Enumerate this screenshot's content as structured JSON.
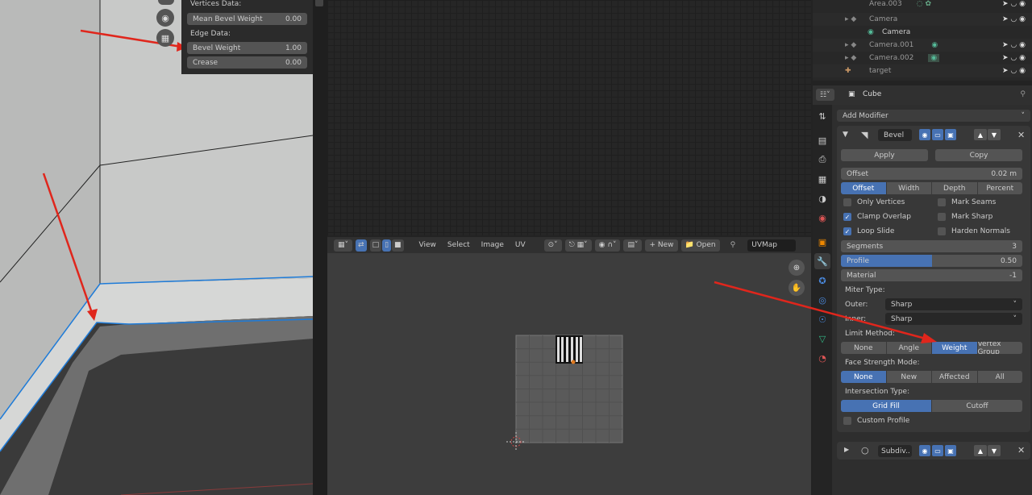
{
  "viewport": {
    "vertices_data_label": "Vertices Data:",
    "mean_bevel_weight_label": "Mean Bevel Weight",
    "mean_bevel_weight_value": "0.00",
    "edge_data_label": "Edge Data:",
    "bevel_weight_label": "Bevel Weight",
    "bevel_weight_value": "1.00",
    "crease_label": "Crease",
    "crease_value": "0.00"
  },
  "uv_editor": {
    "menu": [
      "View",
      "Select",
      "Image",
      "UV"
    ],
    "new_label": "New",
    "open_label": "Open",
    "uvmap_label": "UVMap"
  },
  "outliner": {
    "items": [
      "Area.003",
      "Camera",
      "Camera",
      "Camera.001",
      "Camera.002",
      "target"
    ]
  },
  "properties": {
    "object_name": "Cube",
    "add_modifier": "Add Modifier",
    "bevel": {
      "name": "Bevel",
      "apply": "Apply",
      "copy": "Copy",
      "offset_label": "Offset",
      "offset_value": "0.02 m",
      "width_types": [
        "Offset",
        "Width",
        "Depth",
        "Percent"
      ],
      "only_vertices": "Only Vertices",
      "mark_seams": "Mark Seams",
      "clamp_overlap": "Clamp Overlap",
      "mark_sharp": "Mark Sharp",
      "loop_slide": "Loop Slide",
      "harden_normals": "Harden Normals",
      "segments_label": "Segments",
      "segments_value": "3",
      "profile_label": "Profile",
      "profile_value": "0.50",
      "profile_fraction": 0.5,
      "material_label": "Material",
      "material_value": "-1",
      "miter_type_label": "Miter Type:",
      "outer_label": "Outer:",
      "outer_value": "Sharp",
      "inner_label": "Inner:",
      "inner_value": "Sharp",
      "limit_method_label": "Limit Method:",
      "limit_methods": [
        "None",
        "Angle",
        "Weight",
        "Vertex Group"
      ],
      "face_strength_label": "Face Strength Mode:",
      "face_strength_modes": [
        "None",
        "New",
        "Affected",
        "All"
      ],
      "intersection_label": "Intersection Type:",
      "intersection_types": [
        "Grid Fill",
        "Cutoff"
      ],
      "custom_profile": "Custom Profile"
    },
    "subdiv_name": "Subdiv.."
  },
  "colors": {
    "accent": "#4772b3",
    "arrow": "#e0261c",
    "edge_select": "#1e7bd8"
  }
}
